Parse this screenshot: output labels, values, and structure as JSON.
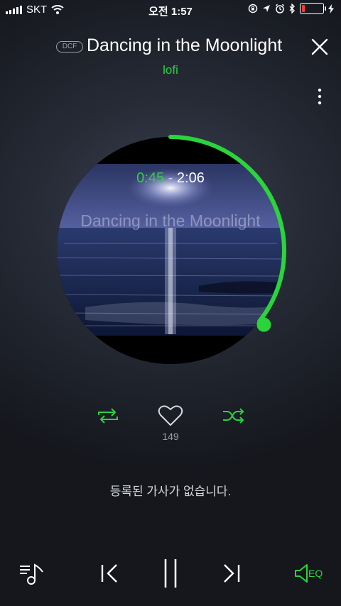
{
  "status_bar": {
    "carrier": "SKT",
    "time": "오전 1:57",
    "battery_level": 0.15
  },
  "header": {
    "badge": "DCF",
    "title": "Dancing in the Moonlight",
    "artist": "lofi"
  },
  "player": {
    "current_time": "0:45",
    "separator": "-",
    "total_time": "2:06",
    "progress": 0.357,
    "art_title": "Dancing in the Moonlight",
    "like_count": "149"
  },
  "lyrics": {
    "message": "등록된 가사가 없습니다."
  },
  "bottom": {
    "eq_label": "EQ"
  },
  "colors": {
    "accent": "#2bd43c",
    "background": "#1d2129"
  },
  "icons": [
    "signal-icon",
    "wifi-icon",
    "lock-rotation-icon",
    "location-icon",
    "alarm-icon",
    "bluetooth-icon",
    "battery-icon",
    "charging-icon",
    "close-icon",
    "more-icon",
    "repeat-icon",
    "heart-icon",
    "shuffle-icon",
    "playlist-icon",
    "previous-icon",
    "pause-icon",
    "next-icon",
    "eq-speaker-icon"
  ]
}
